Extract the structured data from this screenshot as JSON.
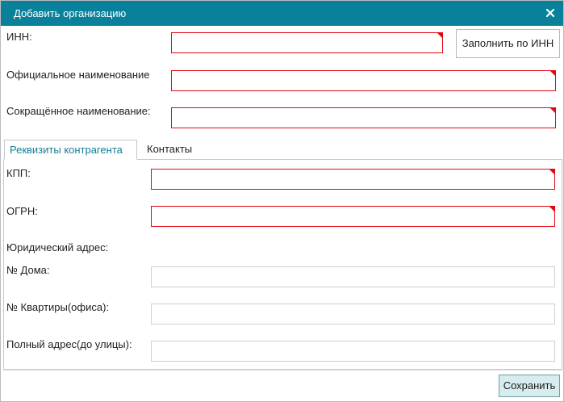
{
  "dialog": {
    "title": "Добавить организацию",
    "close_icon": "close-icon",
    "accent_color": "#0a819b",
    "required_color": "#e30613"
  },
  "fields": {
    "inn_label": "ИНН:",
    "official_name_label": "Официальное наименование",
    "short_name_label": "Сокращённое наименование:",
    "inn_value": "",
    "official_name_value": "",
    "short_name_value": ""
  },
  "fill_by_inn_button": "Заполнить по ИНН",
  "tabs": [
    {
      "label": "Реквизиты контрагента",
      "active": true
    },
    {
      "label": "Контакты",
      "active": false
    }
  ],
  "requisites": {
    "kpp_label": "КПП:",
    "ogrn_label": "ОГРН:",
    "legal_address_heading": "Юридический адрес:",
    "house_number_label": "№ Дома:",
    "apartment_label": "№ Квартиры(офиса):",
    "full_address_label": "Полный адрес(до улицы):",
    "kpp_value": "",
    "ogrn_value": "",
    "house_number_value": "",
    "apartment_value": "",
    "full_address_value": ""
  },
  "save_button": "Сохранить"
}
